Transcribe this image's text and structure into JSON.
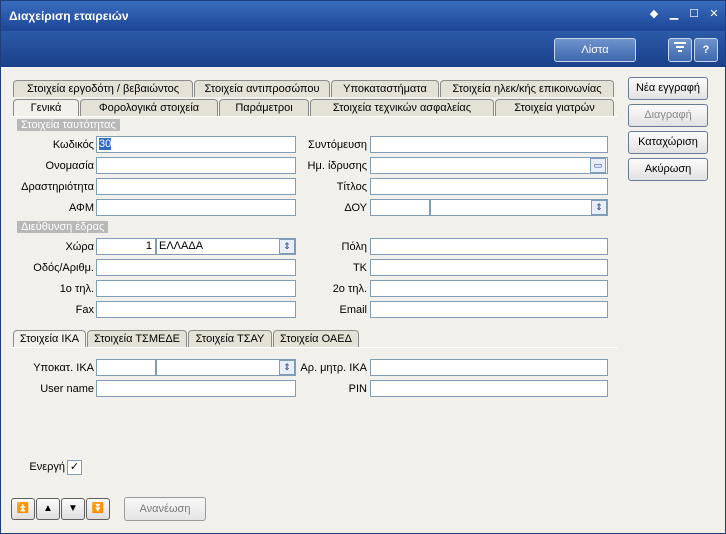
{
  "window": {
    "title": "Διαχείριση εταιρειών"
  },
  "toolbar": {
    "list_label": "Λίστα",
    "filter_icon": "filter-icon",
    "help_label": "?"
  },
  "tabs_row1": [
    "Στοιχεία εργοδότη / βεβαιώντος",
    "Στοιχεία αντιπροσώπου",
    "Υποκαταστήματα",
    "Στοιχεία ηλεκ/κής επικοινωνίας"
  ],
  "tabs_row2": [
    "Γενικά",
    "Φορολογικά στοιχεία",
    "Παράμετροι",
    "Στοιχεία τεχνικών ασφαλείας",
    "Στοιχεία γιατρών"
  ],
  "identity": {
    "section": "Στοιχεία ταυτότητας",
    "code_label": "Κωδικός",
    "code_value": "30",
    "abbrev_label": "Συντόμευση",
    "abbrev_value": "",
    "name_label": "Ονομασία",
    "name_value": "",
    "founded_label": "Ημ. ίδρυσης",
    "founded_value": "",
    "activity_label": "Δραστηριότητα",
    "activity_value": "",
    "title_label": "Τίτλος",
    "title_value": "",
    "afm_label": "ΑΦΜ",
    "afm_value": "",
    "doy_label": "ΔΟΥ",
    "doy_code": "",
    "doy_name": ""
  },
  "address": {
    "section": "Διεύθυνση έδρας",
    "country_label": "Χώρα",
    "country_code": "1",
    "country_name": "ΕΛΛΑΔΑ",
    "city_label": "Πόλη",
    "city_value": "",
    "street_label": "Οδός/Αριθμ.",
    "street_value": "",
    "zip_label": "ΤΚ",
    "zip_value": "",
    "phone1_label": "1ο τηλ.",
    "phone1_value": "",
    "phone2_label": "2ο τηλ.",
    "phone2_value": "",
    "fax_label": "Fax",
    "fax_value": "",
    "email_label": "Email",
    "email_value": ""
  },
  "subtabs": [
    "Στοιχεία ΙΚΑ",
    "Στοιχεία ΤΣΜΕΔΕ",
    "Στοιχεία ΤΣΑΥ",
    "Στοιχεία ΟΑΕΔ"
  ],
  "ika": {
    "branch_label": "Υποκατ. ΙΚΑ",
    "branch_code": "",
    "branch_name": "",
    "registry_label": "Αρ. μητρ. ΙΚΑ",
    "registry_value": "",
    "user_label": "User name",
    "user_value": "",
    "pin_label": "PIN",
    "pin_value": ""
  },
  "active": {
    "label": "Ενεργή",
    "checked": true
  },
  "actions": {
    "new": "Νέα εγγραφή",
    "delete": "Διαγραφή",
    "save": "Καταχώριση",
    "cancel": "Ακύρωση"
  },
  "bottom": {
    "refresh": "Ανανέωση"
  }
}
